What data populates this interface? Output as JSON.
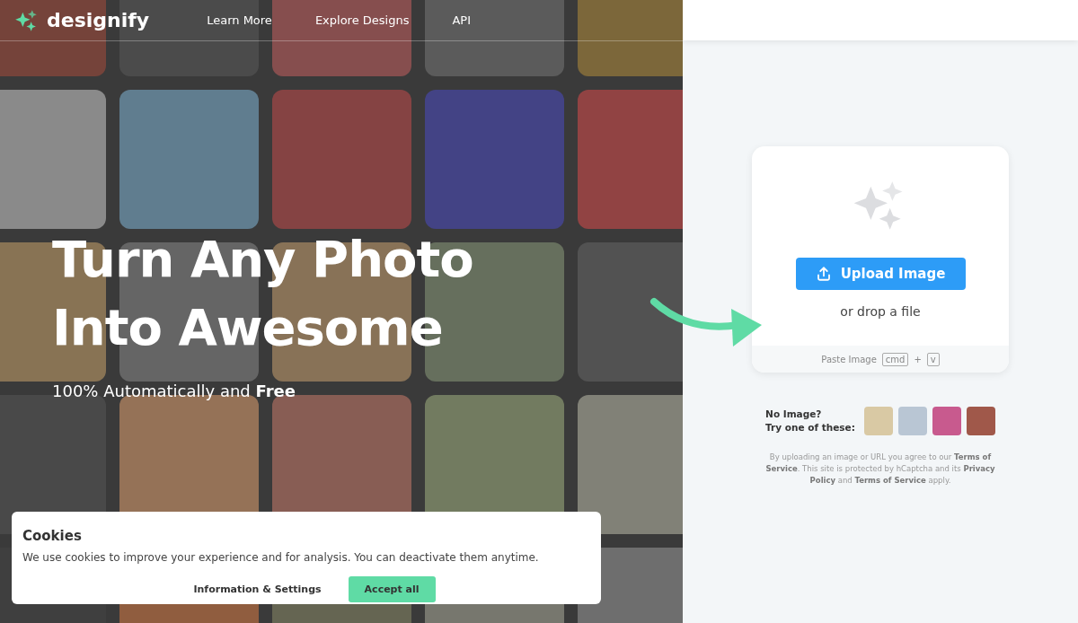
{
  "nav": {
    "brand": "designify",
    "links": [
      "Learn More",
      "Explore Designs",
      "API"
    ]
  },
  "hero": {
    "title_lines": [
      "Turn Any Photo",
      "Into Awesome"
    ],
    "subtitle": "100% Automatically and **Free**"
  },
  "upload": {
    "button": "Upload Image",
    "drop_hint": "or drop a file",
    "paste_label": "Paste Image",
    "keys": [
      "cmd",
      "v"
    ],
    "plus": "+"
  },
  "samples": {
    "label_lines": [
      "No Image?",
      "Try one of these:"
    ],
    "thumbs": [
      {
        "color": "#d9c9a4"
      },
      {
        "color": "#b9c6d4"
      },
      {
        "color": "#c85a8e"
      },
      {
        "color": "#a0584a"
      }
    ]
  },
  "legal": "By uploading an image or URL you agree to our **Terms of Service**. This site is protected by hCaptcha and its **Privacy Policy** and **Terms of Service** apply.",
  "cookies": {
    "title": "Cookies",
    "text": "We use cookies to improve your experience and for analysis. You can deactivate them anytime.",
    "buttons": [
      {
        "label": "Information & Settings",
        "kind": "plain"
      },
      {
        "label": "Accept all",
        "kind": "primary"
      }
    ]
  }
}
